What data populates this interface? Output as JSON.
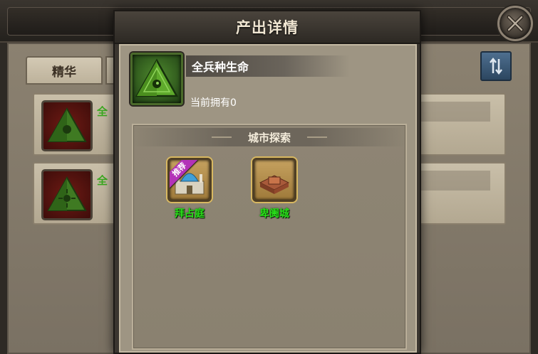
{
  "background": {
    "tab_label": "精华",
    "rows": [
      {
        "stub": "全"
      },
      {
        "stub": "全"
      }
    ]
  },
  "modal": {
    "title": "产出详情",
    "item": {
      "name": "全兵种生命",
      "owned_text": "当前拥有0"
    },
    "source_section": {
      "title": "城市探索",
      "cities": [
        {
          "name": "拜占庭",
          "badge": "推荐",
          "icon": "byzantium-palace-icon"
        },
        {
          "name": "卑阓城",
          "badge": "",
          "icon": "fortress-city-icon"
        }
      ]
    }
  },
  "colors": {
    "city_label": "#29e01a",
    "badge": "#b332b8",
    "item_border": "#4a6a2a"
  }
}
